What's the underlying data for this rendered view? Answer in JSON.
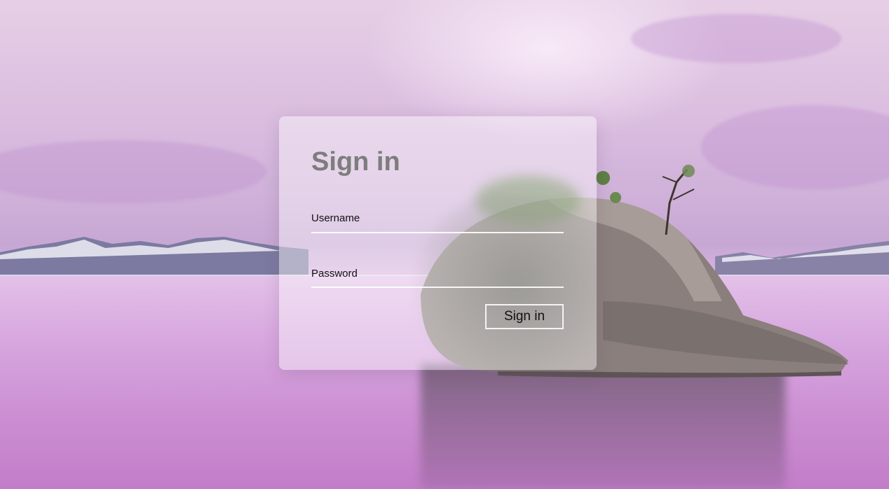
{
  "login": {
    "title": "Sign in",
    "username_label": "Username",
    "password_label": "Password",
    "submit_label": "Sign in"
  }
}
